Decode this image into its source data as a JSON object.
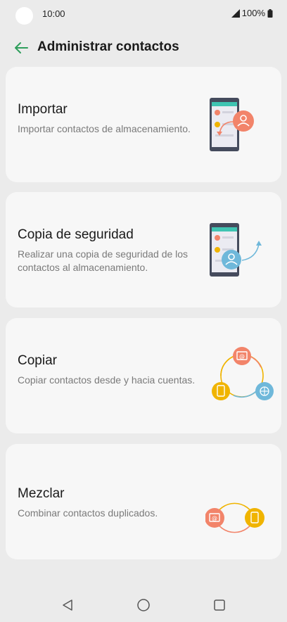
{
  "status": {
    "time": "10:00",
    "battery": "100%"
  },
  "header": {
    "title": "Administrar contactos",
    "back_icon": "arrow-left-icon"
  },
  "cards": [
    {
      "title": "Importar",
      "description": "Importar contactos de almacenamiento.",
      "illustration": "import-phone-icon"
    },
    {
      "title": "Copia de seguridad",
      "description": "Realizar una copia de seguridad de los contactos al almacenamiento.",
      "illustration": "backup-phone-icon"
    },
    {
      "title": "Copiar",
      "description": "Copiar contactos desde y hacia cuentas.",
      "illustration": "copy-cycle-icon"
    },
    {
      "title": "Mezclar",
      "description": "Combinar contactos duplicados.",
      "illustration": "merge-icon"
    }
  ],
  "nav": {
    "back": "nav-back-icon",
    "home": "nav-home-icon",
    "recents": "nav-recents-icon"
  },
  "colors": {
    "accent_green": "#2e9e5b",
    "coral": "#f2846a",
    "amber": "#f0b400",
    "sky": "#6fb8da",
    "phone": "#454b5d"
  }
}
